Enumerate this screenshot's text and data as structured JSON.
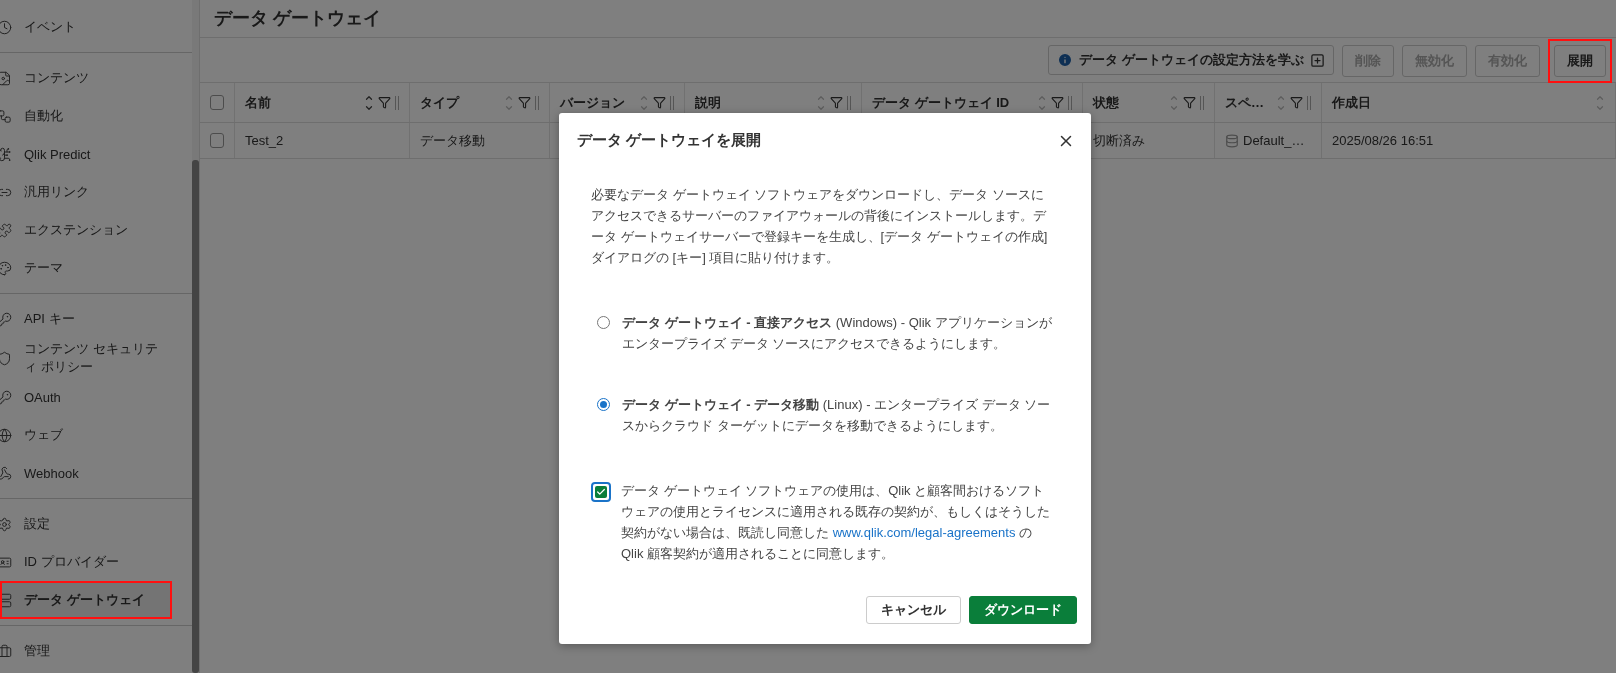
{
  "sidebar": {
    "groups": [
      {
        "items": [
          {
            "label": "イベント",
            "selected": false,
            "highlighted": false
          }
        ]
      },
      {
        "items": [
          {
            "label": "コンテンツ",
            "selected": false,
            "highlighted": false
          },
          {
            "label": "自動化",
            "selected": false,
            "highlighted": false
          },
          {
            "label": "Qlik Predict",
            "selected": false,
            "highlighted": false
          },
          {
            "label": "汎用リンク",
            "selected": false,
            "highlighted": false
          },
          {
            "label": "エクステンション",
            "selected": false,
            "highlighted": false
          },
          {
            "label": "テーマ",
            "selected": false,
            "highlighted": false
          }
        ]
      },
      {
        "items": [
          {
            "label": "API キー",
            "selected": false,
            "highlighted": false
          },
          {
            "label": "コンテンツ セキュリティ ポリシー",
            "selected": false,
            "highlighted": false
          },
          {
            "label": "OAuth",
            "selected": false,
            "highlighted": false
          },
          {
            "label": "ウェブ",
            "selected": false,
            "highlighted": false
          },
          {
            "label": "Webhook",
            "selected": false,
            "highlighted": false
          }
        ]
      },
      {
        "items": [
          {
            "label": "設定",
            "selected": false,
            "highlighted": false
          },
          {
            "label": "ID プロバイダー",
            "selected": false,
            "highlighted": false
          },
          {
            "label": "データ ゲートウェイ",
            "selected": true,
            "highlighted": true
          }
        ]
      },
      {
        "items": [
          {
            "label": "管理",
            "selected": false,
            "highlighted": false
          }
        ]
      }
    ]
  },
  "page": {
    "title": "データ ゲートウェイ"
  },
  "toolbar": {
    "help_link": "データ ゲートウェイの設定方法を学ぶ",
    "buttons": [
      {
        "label": "削除",
        "disabled": true,
        "highlighted": false
      },
      {
        "label": "無効化",
        "disabled": true,
        "highlighted": false
      },
      {
        "label": "有効化",
        "disabled": true,
        "highlighted": false
      },
      {
        "label": "展開",
        "disabled": false,
        "highlighted": true
      }
    ]
  },
  "table": {
    "all_checked": false,
    "columns": [
      {
        "label": "名前",
        "sorted": true,
        "filter": true
      },
      {
        "label": "タイプ",
        "sorted": false,
        "filter": true
      },
      {
        "label": "バージョン",
        "sorted": false,
        "filter": true
      },
      {
        "label": "説明",
        "sorted": false,
        "filter": true
      },
      {
        "label": "データ ゲートウェイ ID",
        "sorted": false,
        "filter": true
      },
      {
        "label": "状態",
        "sorted": false,
        "filter": true
      },
      {
        "label": "スペ…",
        "sorted": false,
        "filter": true
      },
      {
        "label": "作成日",
        "sorted": false,
        "filter": false
      }
    ],
    "rows": [
      {
        "checked": false,
        "cells": [
          "Test_2",
          "データ移動",
          "",
          "",
          "",
          "切断済み",
          "Default_…",
          "2025/08/26 16:51"
        ]
      }
    ]
  },
  "dialog": {
    "title": "データ ゲートウェイを展開",
    "description": "必要なデータ ゲートウェイ ソフトウェアをダウンロードし、データ ソースにアクセスできるサーバーのファイアウォールの背後にインストールします。データ ゲートウェイサーバーで登録キーを生成し、[データ ゲートウェイの作成] ダイアログの [キー] 項目に貼り付けます。",
    "options": [
      {
        "label": "**データ ゲートウェイ - 直接アクセス** (Windows) - Qlik アプリケーションがエンタープライズ データ ソースにアクセスできるようにします。",
        "selected": false
      },
      {
        "label": "**データ ゲートウェイ - データ移動** (Linux) - エンタープライズ データ ソースからクラウド ターゲットにデータを移動できるようにします。",
        "selected": true
      }
    ],
    "agreement": {
      "checked": true,
      "text_before": "データ ゲートウェイ ソフトウェアの使用は、Qlik と顧客間おけるソフトウェアの使用とライセンスに適用される既存の契約が、もしくはそうした契約がない場合は、既読し同意した ",
      "link": "www.qlik.com/legal-agreements",
      "text_after": " の Qlik 顧客契約が適用されることに同意します。"
    },
    "cancel": "キャンセル",
    "download": "ダウンロード"
  }
}
